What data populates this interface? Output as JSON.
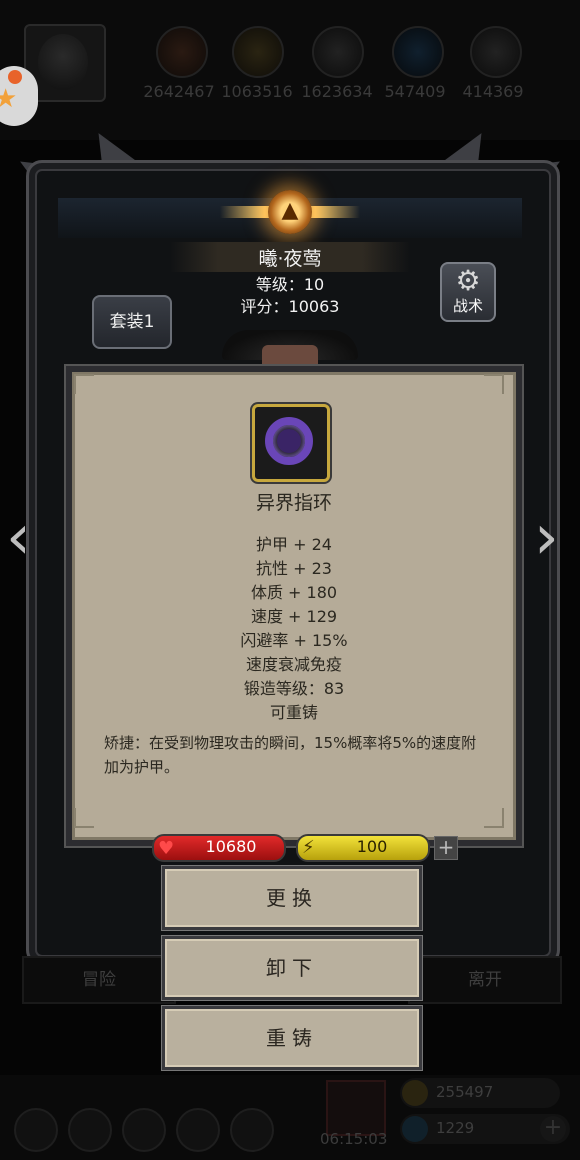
{
  "resources": [
    "2642467",
    "1063516",
    "1623634",
    "547409",
    "414369"
  ],
  "hero": {
    "name": "曦·夜莺",
    "level": "等级：10",
    "score": "评分：10063"
  },
  "buttons": {
    "suit": "套装1",
    "tactics": "战术",
    "replace": "更换",
    "unequip": "卸下",
    "reforge": "重铸",
    "adventure": "冒险",
    "leave": "离开"
  },
  "item": {
    "name": "异界指环",
    "icon": "purple-ring-icon",
    "stats": [
      "护甲 + 24",
      "抗性 + 23",
      "体质 + 180",
      "速度 + 129",
      "闪避率 + 15%",
      "速度衰减免疫",
      "锻造等级：83",
      "可重铸"
    ],
    "description": "矫捷：在受到物理攻击的瞬间，15%概率将5%的速度附加为护甲。"
  },
  "status": {
    "hp": "10680",
    "energy": "100"
  },
  "footer": {
    "timer": "06:15:03",
    "gold": "255497",
    "gems": "1229"
  },
  "colors": {
    "panel": "#b5ab98",
    "hp": "#d42020",
    "energy": "#e6d22a",
    "ring": "#6a46b8"
  }
}
